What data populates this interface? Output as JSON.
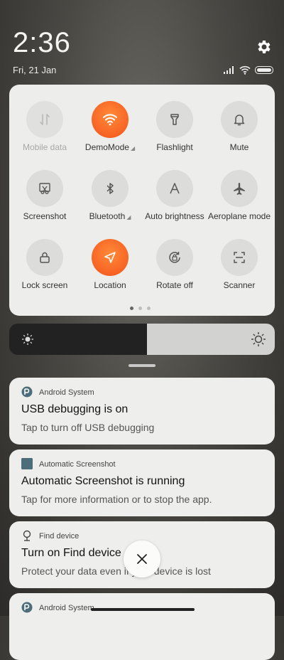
{
  "status_bar": {
    "time": "2:36",
    "date": "Fri, 21 Jan",
    "icons": [
      "signal-icon",
      "wifi-icon",
      "battery-icon"
    ]
  },
  "quick_settings": {
    "tiles": [
      {
        "label": "Mobile data",
        "icon": "mobile-data-icon",
        "state": "disabled"
      },
      {
        "label": "DemoMode",
        "icon": "wifi-icon",
        "state": "active",
        "expandable": true
      },
      {
        "label": "Flashlight",
        "icon": "flashlight-icon",
        "state": "off"
      },
      {
        "label": "Mute",
        "icon": "bell-icon",
        "state": "off"
      },
      {
        "label": "Screenshot",
        "icon": "scissors-icon",
        "state": "off"
      },
      {
        "label": "Bluetooth",
        "icon": "bluetooth-icon",
        "state": "off",
        "expandable": true
      },
      {
        "label": "Auto brightness",
        "icon": "auto-brightness-icon",
        "state": "off"
      },
      {
        "label": "Aeroplane mode",
        "icon": "airplane-icon",
        "state": "off"
      },
      {
        "label": "Lock screen",
        "icon": "lock-icon",
        "state": "off"
      },
      {
        "label": "Location",
        "icon": "location-icon",
        "state": "active"
      },
      {
        "label": "Rotate off",
        "icon": "rotate-lock-icon",
        "state": "off"
      },
      {
        "label": "Scanner",
        "icon": "scanner-icon",
        "state": "off"
      }
    ],
    "page_count": 3,
    "current_page": 1
  },
  "brightness": {
    "level": 0.52
  },
  "notifications": [
    {
      "app": "Android System",
      "title": "USB debugging is on",
      "text": "Tap to turn off USB debugging",
      "icon": "android-system-icon"
    },
    {
      "app": "Automatic Screenshot",
      "title": "Automatic Screenshot is running",
      "text": "Tap for more information or to stop the app.",
      "icon": "app-square-icon"
    },
    {
      "app": "Find device",
      "title": "Turn on Find device",
      "text": "Protect your data even if your device is lost",
      "icon": "location-pin-icon"
    },
    {
      "app": "Android System",
      "title": "",
      "text": "",
      "icon": "android-system-icon"
    }
  ],
  "colors": {
    "accent": "#f4521a",
    "panel": "#ededeb"
  }
}
